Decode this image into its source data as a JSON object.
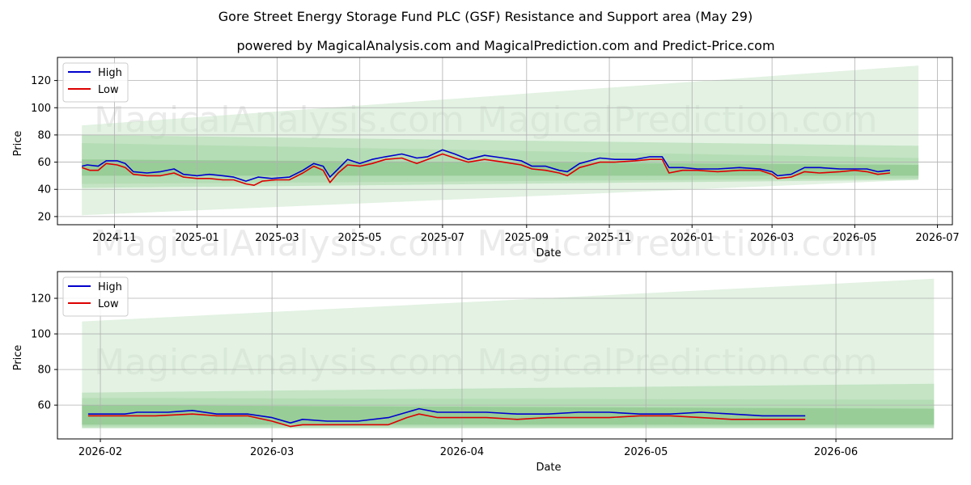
{
  "figure": {
    "title": "Gore Street Energy Storage Fund PLC (GSF) Resistance and Support area (May 29)",
    "subtitle": "powered by MagicalAnalysis.com and MagicalPrediction.com and Predict-Price.com",
    "watermarks": [
      "MagicalAnalysis.com",
      "MagicalPrediction.com"
    ]
  },
  "colors": {
    "high": "#0000cc",
    "low": "#dd0000",
    "band_light": "#c8e6c8",
    "band_mid": "#a6d6a6",
    "band_dark": "#7fc07f",
    "grid": "#b0b0b0"
  },
  "chart_data": [
    {
      "type": "line",
      "xlabel": "Date",
      "ylabel": "Price",
      "x_range": [
        "2024-09-20",
        "2026-07-12"
      ],
      "ylim": [
        14,
        137
      ],
      "x_ticks": [
        {
          "date": "2024-11-01",
          "label": "2024-11"
        },
        {
          "date": "2025-01-01",
          "label": "2025-01"
        },
        {
          "date": "2025-03-01",
          "label": "2025-03"
        },
        {
          "date": "2025-05-01",
          "label": "2025-05"
        },
        {
          "date": "2025-07-01",
          "label": "2025-07"
        },
        {
          "date": "2025-09-01",
          "label": "2025-09"
        },
        {
          "date": "2025-11-01",
          "label": "2025-11"
        },
        {
          "date": "2026-01-01",
          "label": "2026-01"
        },
        {
          "date": "2026-03-01",
          "label": "2026-03"
        },
        {
          "date": "2026-05-01",
          "label": "2026-05"
        },
        {
          "date": "2026-07-01",
          "label": "2026-07"
        }
      ],
      "y_ticks": [
        20,
        40,
        60,
        80,
        100,
        120
      ],
      "grid": true,
      "legend": "top-left",
      "series": [
        {
          "name": "High",
          "points": [
            [
              "2024-10-08",
              57
            ],
            [
              "2024-10-12",
              58
            ],
            [
              "2024-10-20",
              57
            ],
            [
              "2024-10-26",
              61
            ],
            [
              "2024-11-03",
              61
            ],
            [
              "2024-11-09",
              59
            ],
            [
              "2024-11-15",
              53
            ],
            [
              "2024-11-25",
              52
            ],
            [
              "2024-12-05",
              53
            ],
            [
              "2024-12-15",
              55
            ],
            [
              "2024-12-22",
              51
            ],
            [
              "2025-01-01",
              50
            ],
            [
              "2025-01-10",
              51
            ],
            [
              "2025-01-20",
              50
            ],
            [
              "2025-01-28",
              49
            ],
            [
              "2025-02-06",
              46
            ],
            [
              "2025-02-15",
              49
            ],
            [
              "2025-02-25",
              48
            ],
            [
              "2025-03-10",
              49
            ],
            [
              "2025-03-20",
              54
            ],
            [
              "2025-03-28",
              59
            ],
            [
              "2025-04-04",
              57
            ],
            [
              "2025-04-09",
              49
            ],
            [
              "2025-04-15",
              55
            ],
            [
              "2025-04-22",
              62
            ],
            [
              "2025-05-01",
              59
            ],
            [
              "2025-05-10",
              62
            ],
            [
              "2025-05-20",
              64
            ],
            [
              "2025-06-01",
              66
            ],
            [
              "2025-06-12",
              63
            ],
            [
              "2025-06-20",
              64
            ],
            [
              "2025-07-01",
              69
            ],
            [
              "2025-07-10",
              66
            ],
            [
              "2025-07-20",
              62
            ],
            [
              "2025-08-01",
              65
            ],
            [
              "2025-08-15",
              63
            ],
            [
              "2025-08-28",
              61
            ],
            [
              "2025-09-05",
              57
            ],
            [
              "2025-09-15",
              57
            ],
            [
              "2025-09-25",
              54
            ],
            [
              "2025-10-01",
              53
            ],
            [
              "2025-10-10",
              59
            ],
            [
              "2025-10-25",
              63
            ],
            [
              "2025-11-05",
              62
            ],
            [
              "2025-11-20",
              62
            ],
            [
              "2025-12-01",
              64
            ],
            [
              "2025-12-10",
              64
            ],
            [
              "2025-12-15",
              56
            ],
            [
              "2025-12-25",
              56
            ],
            [
              "2026-01-05",
              55
            ],
            [
              "2026-01-20",
              55
            ],
            [
              "2026-02-05",
              56
            ],
            [
              "2026-02-20",
              55
            ],
            [
              "2026-03-01",
              53
            ],
            [
              "2026-03-05",
              50
            ],
            [
              "2026-03-15",
              51
            ],
            [
              "2026-03-25",
              56
            ],
            [
              "2026-04-05",
              56
            ],
            [
              "2026-04-20",
              55
            ],
            [
              "2026-05-01",
              55
            ],
            [
              "2026-05-10",
              55
            ],
            [
              "2026-05-18",
              53
            ],
            [
              "2026-05-27",
              54
            ]
          ]
        },
        {
          "name": "Low",
          "points": [
            [
              "2024-10-08",
              56
            ],
            [
              "2024-10-14",
              54
            ],
            [
              "2024-10-20",
              54
            ],
            [
              "2024-10-26",
              59
            ],
            [
              "2024-11-03",
              58
            ],
            [
              "2024-11-09",
              56
            ],
            [
              "2024-11-15",
              51
            ],
            [
              "2024-11-25",
              50
            ],
            [
              "2024-12-05",
              50
            ],
            [
              "2024-12-15",
              52
            ],
            [
              "2024-12-22",
              49
            ],
            [
              "2025-01-01",
              48
            ],
            [
              "2025-01-10",
              48
            ],
            [
              "2025-01-20",
              47
            ],
            [
              "2025-01-28",
              47
            ],
            [
              "2025-02-06",
              44
            ],
            [
              "2025-02-12",
              43
            ],
            [
              "2025-02-18",
              46
            ],
            [
              "2025-02-28",
              47
            ],
            [
              "2025-03-10",
              47
            ],
            [
              "2025-03-20",
              52
            ],
            [
              "2025-03-28",
              57
            ],
            [
              "2025-04-04",
              54
            ],
            [
              "2025-04-09",
              45
            ],
            [
              "2025-04-15",
              52
            ],
            [
              "2025-04-22",
              58
            ],
            [
              "2025-05-01",
              57
            ],
            [
              "2025-05-10",
              59
            ],
            [
              "2025-05-20",
              62
            ],
            [
              "2025-06-01",
              63
            ],
            [
              "2025-06-12",
              59
            ],
            [
              "2025-06-20",
              62
            ],
            [
              "2025-07-01",
              66
            ],
            [
              "2025-07-10",
              63
            ],
            [
              "2025-07-20",
              60
            ],
            [
              "2025-08-01",
              62
            ],
            [
              "2025-08-15",
              60
            ],
            [
              "2025-08-28",
              58
            ],
            [
              "2025-09-05",
              55
            ],
            [
              "2025-09-15",
              54
            ],
            [
              "2025-09-25",
              52
            ],
            [
              "2025-10-01",
              50
            ],
            [
              "2025-10-10",
              56
            ],
            [
              "2025-10-25",
              60
            ],
            [
              "2025-11-05",
              60
            ],
            [
              "2025-11-20",
              61
            ],
            [
              "2025-12-01",
              62
            ],
            [
              "2025-12-10",
              62
            ],
            [
              "2025-12-15",
              52
            ],
            [
              "2025-12-25",
              54
            ],
            [
              "2026-01-05",
              54
            ],
            [
              "2026-01-20",
              53
            ],
            [
              "2026-02-05",
              54
            ],
            [
              "2026-02-20",
              54
            ],
            [
              "2026-03-01",
              51
            ],
            [
              "2026-03-05",
              48
            ],
            [
              "2026-03-15",
              49
            ],
            [
              "2026-03-25",
              53
            ],
            [
              "2026-04-05",
              52
            ],
            [
              "2026-04-20",
              53
            ],
            [
              "2026-05-01",
              54
            ],
            [
              "2026-05-10",
              53
            ],
            [
              "2026-05-18",
              51
            ],
            [
              "2026-05-27",
              52
            ]
          ]
        }
      ],
      "bands": [
        {
          "shade": "light",
          "start": "2024-10-08",
          "end": "2026-06-17",
          "lower_start": 21,
          "upper_start": 87,
          "lower_end": 47,
          "upper_end": 131
        },
        {
          "shade": "mid",
          "start": "2024-10-08",
          "end": "2026-06-17",
          "lower_start": 41,
          "upper_start": 80,
          "lower_end": 47,
          "upper_end": 72
        },
        {
          "shade": "mid",
          "start": "2024-10-08",
          "end": "2026-06-17",
          "lower_start": 44,
          "upper_start": 74,
          "lower_end": 48,
          "upper_end": 63
        },
        {
          "shade": "dark",
          "start": "2024-10-08",
          "end": "2026-06-17",
          "lower_start": 50,
          "upper_start": 62,
          "lower_end": 50,
          "upper_end": 58
        }
      ]
    },
    {
      "type": "line",
      "xlabel": "Date",
      "ylabel": "Price",
      "x_range": [
        "2026-01-25",
        "2026-06-20"
      ],
      "ylim": [
        41,
        135
      ],
      "x_ticks": [
        {
          "date": "2026-02-01",
          "label": "2026-02"
        },
        {
          "date": "2026-03-01",
          "label": "2026-03"
        },
        {
          "date": "2026-04-01",
          "label": "2026-04"
        },
        {
          "date": "2026-05-01",
          "label": "2026-05"
        },
        {
          "date": "2026-06-01",
          "label": "2026-06"
        }
      ],
      "y_ticks": [
        60,
        80,
        100,
        120
      ],
      "grid": true,
      "legend": "top-left",
      "series": [
        {
          "name": "High",
          "points": [
            [
              "2026-01-30",
              55
            ],
            [
              "2026-02-05",
              55
            ],
            [
              "2026-02-07",
              56
            ],
            [
              "2026-02-12",
              56
            ],
            [
              "2026-02-16",
              57
            ],
            [
              "2026-02-20",
              55
            ],
            [
              "2026-02-25",
              55
            ],
            [
              "2026-03-01",
              53
            ],
            [
              "2026-03-04",
              50
            ],
            [
              "2026-03-06",
              52
            ],
            [
              "2026-03-10",
              51
            ],
            [
              "2026-03-15",
              51
            ],
            [
              "2026-03-20",
              53
            ],
            [
              "2026-03-23",
              56
            ],
            [
              "2026-03-25",
              58
            ],
            [
              "2026-03-28",
              56
            ],
            [
              "2026-04-01",
              56
            ],
            [
              "2026-04-05",
              56
            ],
            [
              "2026-04-10",
              55
            ],
            [
              "2026-04-15",
              55
            ],
            [
              "2026-04-20",
              56
            ],
            [
              "2026-04-25",
              56
            ],
            [
              "2026-04-30",
              55
            ],
            [
              "2026-05-05",
              55
            ],
            [
              "2026-05-10",
              56
            ],
            [
              "2026-05-15",
              55
            ],
            [
              "2026-05-20",
              54
            ],
            [
              "2026-05-27",
              54
            ]
          ]
        },
        {
          "name": "Low",
          "points": [
            [
              "2026-01-30",
              54
            ],
            [
              "2026-02-05",
              54
            ],
            [
              "2026-02-10",
              54
            ],
            [
              "2026-02-16",
              55
            ],
            [
              "2026-02-20",
              54
            ],
            [
              "2026-02-25",
              54
            ],
            [
              "2026-03-01",
              51
            ],
            [
              "2026-03-04",
              48
            ],
            [
              "2026-03-06",
              49
            ],
            [
              "2026-03-10",
              49
            ],
            [
              "2026-03-15",
              49
            ],
            [
              "2026-03-20",
              49
            ],
            [
              "2026-03-23",
              53
            ],
            [
              "2026-03-25",
              55
            ],
            [
              "2026-03-28",
              53
            ],
            [
              "2026-04-01",
              53
            ],
            [
              "2026-04-05",
              53
            ],
            [
              "2026-04-10",
              52
            ],
            [
              "2026-04-15",
              53
            ],
            [
              "2026-04-20",
              53
            ],
            [
              "2026-04-25",
              53
            ],
            [
              "2026-04-30",
              54
            ],
            [
              "2026-05-05",
              54
            ],
            [
              "2026-05-10",
              53
            ],
            [
              "2026-05-15",
              52
            ],
            [
              "2026-05-20",
              52
            ],
            [
              "2026-05-27",
              52
            ]
          ]
        }
      ],
      "bands": [
        {
          "shade": "light",
          "start": "2026-01-29",
          "end": "2026-06-17",
          "lower_start": 47,
          "upper_start": 107,
          "lower_end": 47,
          "upper_end": 131
        },
        {
          "shade": "mid",
          "start": "2026-01-29",
          "end": "2026-06-17",
          "lower_start": 47,
          "upper_start": 67,
          "lower_end": 47,
          "upper_end": 72
        },
        {
          "shade": "mid",
          "start": "2026-01-29",
          "end": "2026-06-17",
          "lower_start": 48,
          "upper_start": 64,
          "lower_end": 48,
          "upper_end": 63
        },
        {
          "shade": "dark",
          "start": "2026-01-29",
          "end": "2026-06-17",
          "lower_start": 49,
          "upper_start": 60,
          "lower_end": 49,
          "upper_end": 58
        }
      ]
    }
  ]
}
